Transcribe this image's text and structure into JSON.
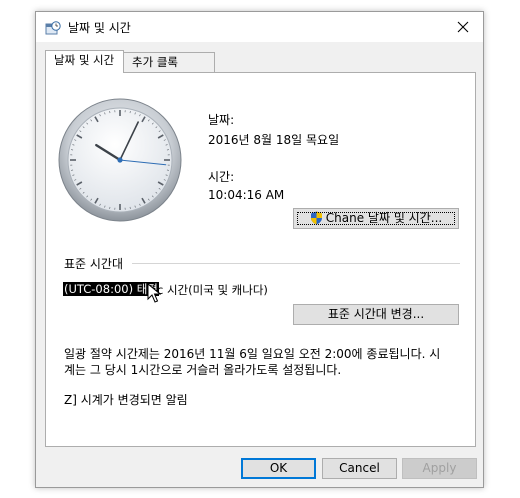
{
  "window": {
    "title": "날짜 및 시간"
  },
  "tabs": [
    {
      "label": "날짜 및 시간"
    },
    {
      "label": "추가 클록"
    }
  ],
  "datetime": {
    "date_label": "날짜:",
    "date_value": "2016년 8월 18일 목요일",
    "time_label": "시간:",
    "time_value": "10:04:16 AM",
    "change_button": "Chan",
    "change_button_rest": "e 날짜 및 시간...",
    "clock": {
      "hour": 10,
      "minute": 4,
      "second": 16
    }
  },
  "timezone": {
    "group_label": "표준 시간대",
    "selected_prefix": "(UTC-08:00) 태평",
    "selected_rest": "양 표준시(미국 및 캐나다)",
    "visible_suffix": "c 시간(미국 및 캐나다)",
    "change_button": "표준 시간대 변경..."
  },
  "dst": {
    "line1": "일광 절약 시간제는 2016년 11월 6일 일요일 오전 2:00에 종료됩니다. 시",
    "line2": "계는 그 당시 1시간으로 거슬러 올라가도록 설정됩니다.",
    "notify_label": "시계가 변경되면 알림",
    "notify_checked": false
  },
  "footer": {
    "ok": "OK",
    "cancel": "Cancel",
    "apply": "Apply"
  },
  "icons": {
    "title_icon": "clock-calendar-icon",
    "close_icon": "close-icon",
    "shield_icon": "uac-shield-icon"
  },
  "colors": {
    "focus_blue": "#0078d7",
    "window_bg": "#f0f0f0"
  }
}
